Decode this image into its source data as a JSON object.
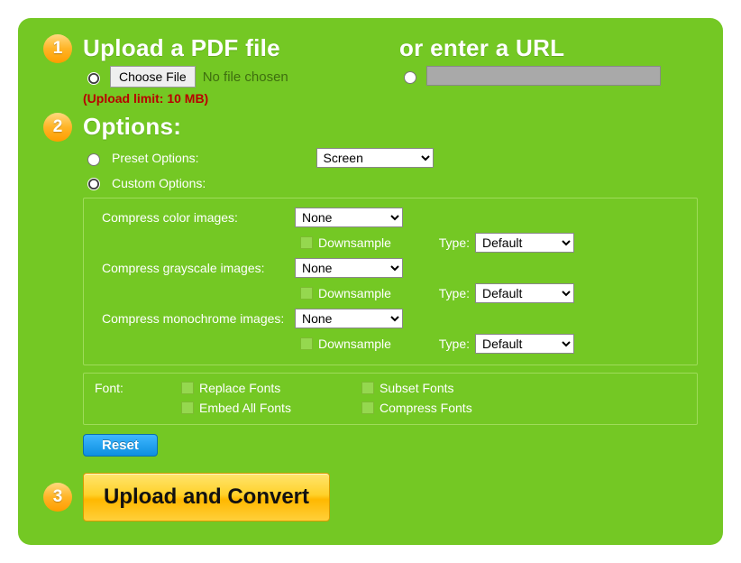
{
  "step1": {
    "badge": "1",
    "heading_left": "Upload a PDF file",
    "heading_right": "or enter a URL",
    "choose_file": "Choose File",
    "no_file": "No file chosen",
    "limit": "(Upload limit: 10 MB)"
  },
  "step2": {
    "badge": "2",
    "heading": "Options:",
    "preset_label": "Preset Options:",
    "preset_value": "Screen",
    "custom_label": "Custom Options:",
    "color": {
      "label": "Compress color images:",
      "value": "None",
      "downsample": "Downsample",
      "type_label": "Type:",
      "type_value": "Default"
    },
    "gray": {
      "label": "Compress grayscale images:",
      "value": "None",
      "downsample": "Downsample",
      "type_label": "Type:",
      "type_value": "Default"
    },
    "mono": {
      "label": "Compress monochrome images:",
      "value": "None",
      "downsample": "Downsample",
      "type_label": "Type:",
      "type_value": "Default"
    },
    "font": {
      "heading": "Font:",
      "replace": "Replace Fonts",
      "subset": "Subset Fonts",
      "embed": "Embed All Fonts",
      "compress": "Compress Fonts"
    },
    "reset": "Reset"
  },
  "step3": {
    "badge": "3",
    "button": "Upload and Convert"
  }
}
